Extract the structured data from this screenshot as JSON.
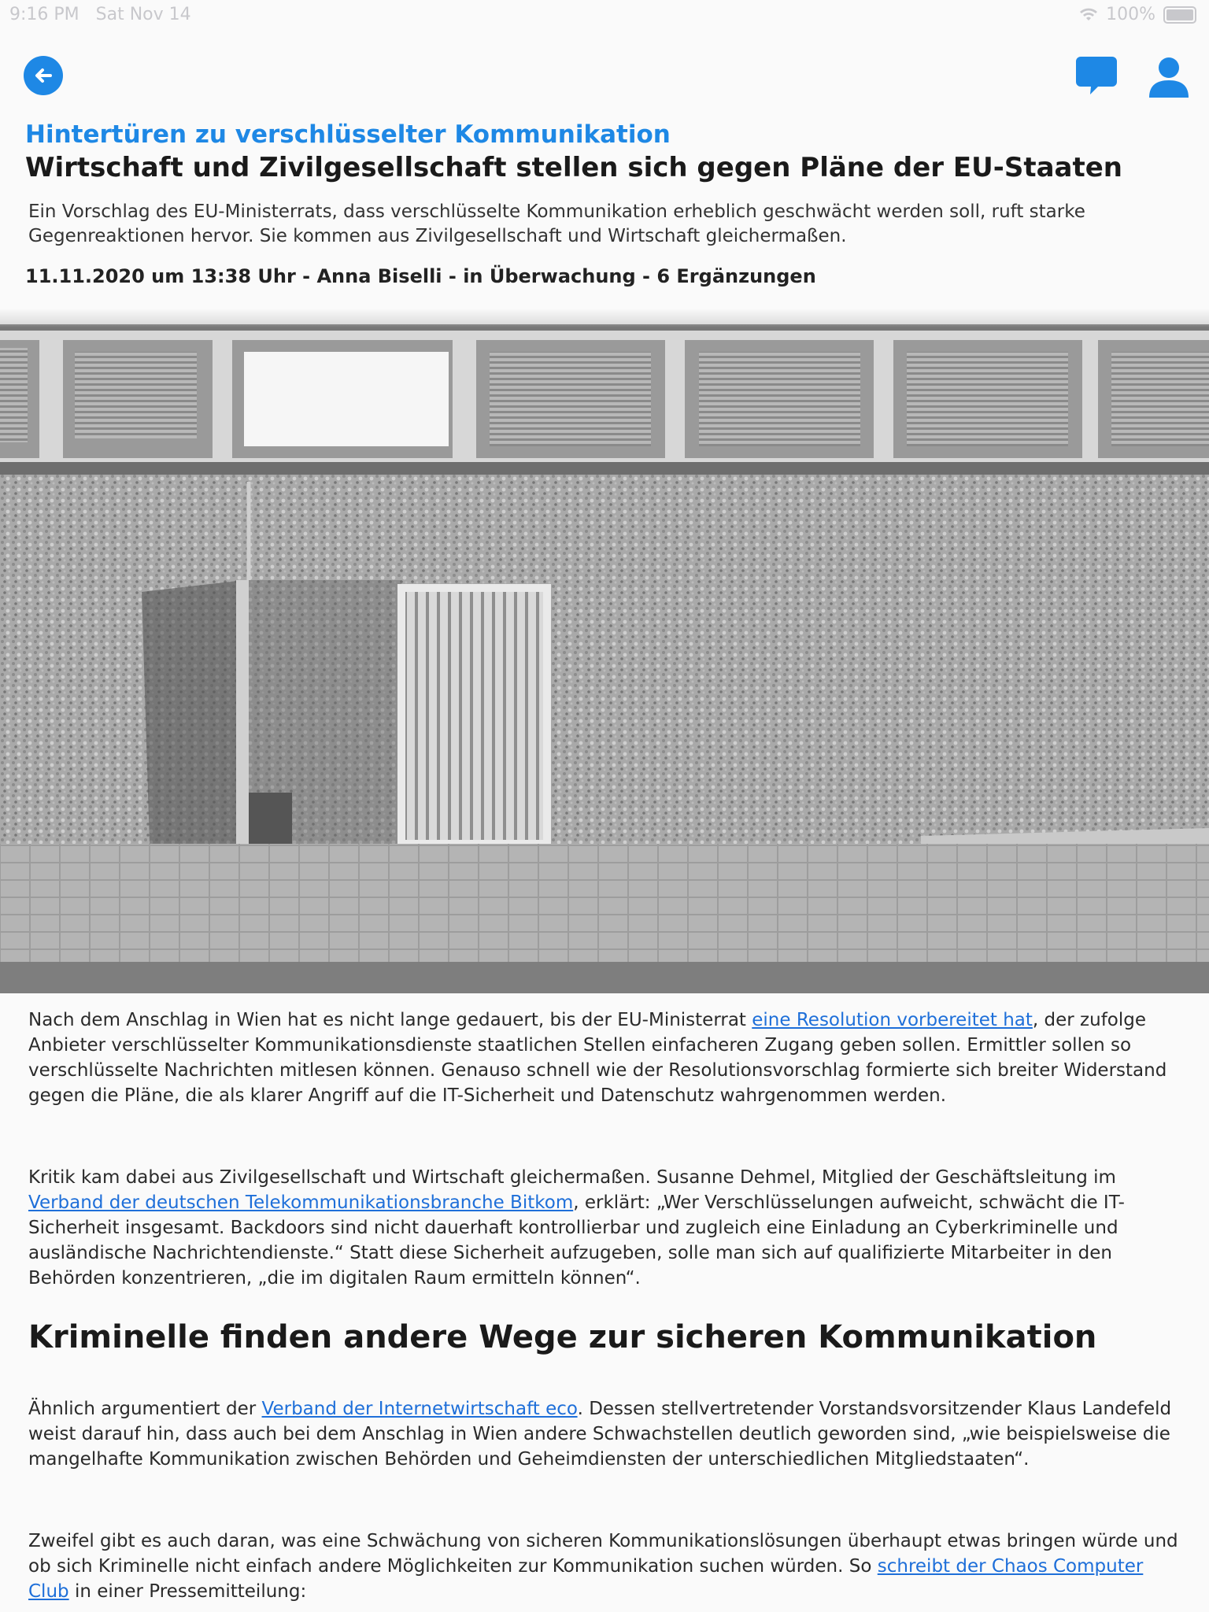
{
  "status_bar": {
    "time": "9:16 PM",
    "date": "Sat Nov 14",
    "battery": "100%"
  },
  "nav": {
    "back_icon": "arrow-left-circle-icon",
    "comments_icon": "speech-bubble-icon",
    "profile_icon": "person-icon"
  },
  "colors": {
    "accent": "#1e88e5",
    "link": "#1e6fd9",
    "text": "#1d1d1f",
    "background": "#fafafa"
  },
  "article": {
    "kicker": "Hintertüren zu verschlüsselter Kommunikation",
    "headline": "Wirtschaft und Zivilgesellschaft stellen sich gegen Pläne der EU-Staaten",
    "teaser": "Ein Vorschlag des EU-Ministerrats, dass verschlüsselte Kommunikation erheblich geschwächt werden soll, ruft starke Gegenreaktionen hervor. Sie kommen aus Zivilgesellschaft und Wirtschaft gleichermaßen.",
    "meta": "11.11.2020 um 13:38 Uhr - Anna Biselli - in Überwachung - 6 Ergänzungen",
    "p1": {
      "before": "Nach dem Anschlag in Wien hat es nicht lange gedauert, bis der EU-Ministerrat ",
      "link": "eine Resolution vorbereitet hat",
      "after": ", der zufolge Anbieter verschlüsselter Kommunikationsdienste staatlichen Stellen einfacheren Zugang geben sollen. Ermittler sollen so verschlüsselte Nachrichten mitlesen können. Genauso schnell wie der Resolutionsvorschlag formierte sich breiter Widerstand gegen die Pläne, die als klarer Angriff auf die IT-Sicherheit und Datenschutz wahrgenommen werden."
    },
    "p2": {
      "before": "Kritik kam dabei aus Zivilgesellschaft und Wirtschaft gleichermaßen. Susanne Dehmel, Mitglied der Geschäftsleitung im ",
      "link": "Verband der deutschen Telekommunikationsbranche Bitkom",
      "after": ", erklärt: „Wer Verschlüsselungen aufweicht, schwächt die IT-Sicherheit insgesamt. Backdoors sind nicht dauerhaft kontrollierbar und zugleich eine Einladung an Cyberkriminelle und ausländische Nachrichtendienste.“ Statt diese Sicherheit aufzugeben, solle man sich auf qualifizierte Mitarbeiter in den Behörden konzentrieren, „die im digitalen Raum ermitteln können“."
    },
    "subheading": "Kriminelle finden andere Wege zur sicheren Kommunikation",
    "p3": {
      "before": "Ähnlich argumentiert der ",
      "link": "Verband der Internetwirtschaft eco",
      "after": ". Dessen stellvertretender Vorstandsvorsitzender Klaus Landefeld weist darauf hin, dass auch bei dem Anschlag in Wien andere Schwachstellen deutlich geworden sind, „wie beispielsweise die mangelhafte Kommunikation zwischen Behörden und Geheimdiensten der unterschiedlichen Mitgliedstaaten“."
    },
    "p4": {
      "before": "Zweifel gibt es auch daran, was eine Schwächung von sicheren Kommunikationslösungen überhaupt etwas bringen würde und ob sich Kriminelle nicht einfach andere Möglichkeiten zur Kommunikation suchen würden. So ",
      "link": "schreibt der Chaos Computer Club",
      "after": " in einer Pressemitteilung:"
    }
  }
}
